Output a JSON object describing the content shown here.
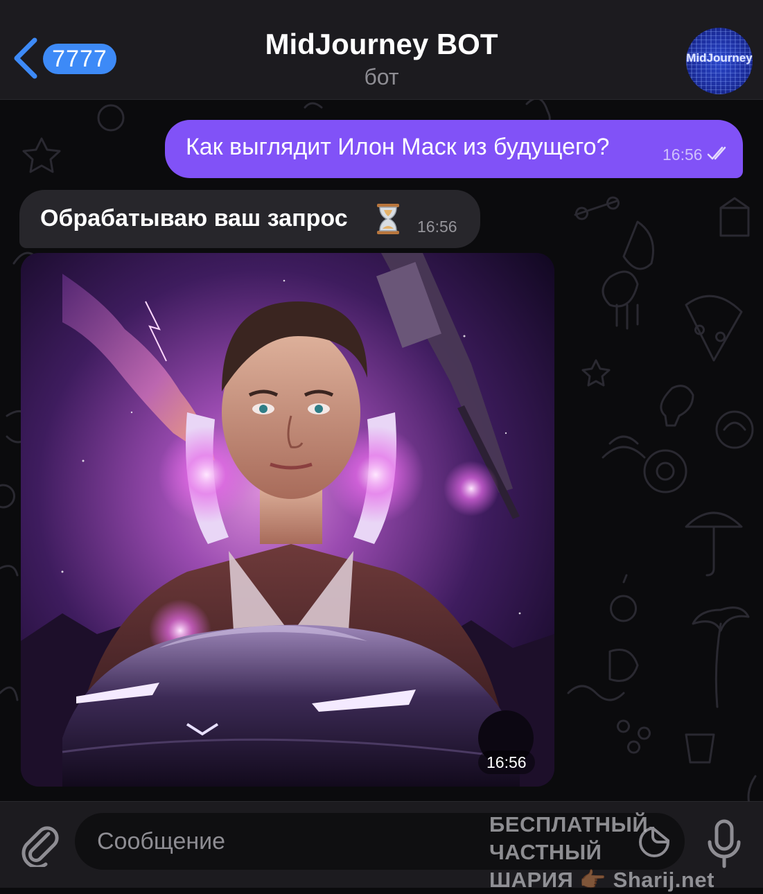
{
  "header": {
    "back_badge": "7777",
    "title": "MidJourney BOT",
    "subtitle": "бот",
    "avatar_logo": "MidJourney"
  },
  "messages": [
    {
      "direction": "out",
      "text": "Как выглядит Илон Маск из будущего?",
      "time": "16:56",
      "status": "read"
    },
    {
      "direction": "in",
      "text": "Обрабатываю ваш запрос",
      "emoji": "hourglass",
      "time": "16:56"
    },
    {
      "direction": "in",
      "type": "image",
      "image_description": "AI-generated futuristic portrait of a man with glowing neon collar in front of a sports car",
      "time": "16:56"
    }
  ],
  "composer": {
    "placeholder": "Сообщение"
  },
  "watermark": {
    "line1": "БЕСПЛАТНЫЙ ЧАСТНЫЙ",
    "line2_text": "ШАРИЯ",
    "line2_emoji": "👉🏾",
    "line2_site": "Sharij.net"
  },
  "colors": {
    "outgoing_bubble": "#8152f7",
    "incoming_bubble": "#27262b",
    "badge": "#3d8af7",
    "header": "#1c1b1f"
  },
  "icons": [
    "chevron-left-icon",
    "read-checks-icon",
    "hourglass-icon",
    "paperclip-icon",
    "sticker-icon",
    "microphone-icon"
  ]
}
